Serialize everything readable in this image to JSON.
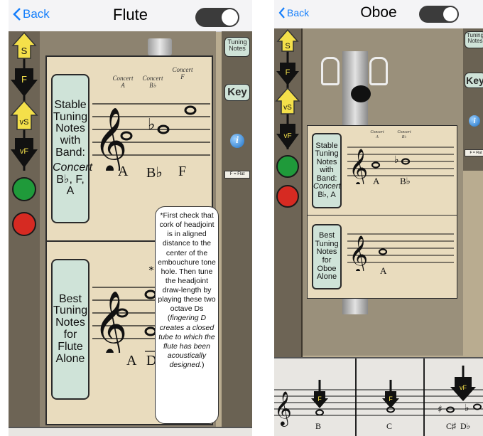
{
  "flute": {
    "back_label": "Back",
    "title": "Flute",
    "tuning_notes_button": "Tuning Notes",
    "key_button": "Key",
    "flat_key_text": "F = Flat",
    "indicators": [
      "S",
      "F",
      "vS",
      "vF"
    ],
    "stable_card": {
      "label_lines": [
        "Stable",
        "Tuning",
        "Notes",
        "with",
        "Band:"
      ],
      "label_concert": "Concert",
      "label_notes": "B♭, F, A",
      "concert_labels": [
        {
          "word": "Concert",
          "note": "A"
        },
        {
          "word": "Concert",
          "note": "B♭"
        },
        {
          "word": "Concert",
          "note": "F"
        }
      ],
      "note_names": [
        "A",
        "B♭",
        "F"
      ]
    },
    "best_card": {
      "label_lines": [
        "Best",
        "Tuning",
        "Notes",
        "for",
        "Flute",
        "Alone"
      ],
      "note_names": [
        "A",
        "D"
      ],
      "asterisk": "*",
      "note_text_pre": "*First check that cork of headjoint is in aligned distance to the center of the embouchure tone hole. Then tune the headjoint draw-length by playing these two octave Ds (",
      "note_text_italic": "fingering D creates a closed tube to which the flute has been acoustically designed.",
      "note_text_post": ")"
    }
  },
  "oboe": {
    "back_label": "Back",
    "title": "Oboe",
    "tuning_notes_button": "Tuning Notes",
    "key_button": "Key",
    "flat_key_text": "F = Flat",
    "indicators": [
      "S",
      "F",
      "vS",
      "vF"
    ],
    "stable_card": {
      "label_lines": [
        "Stable",
        "Tuning",
        "Notes",
        "with",
        "Band:"
      ],
      "label_concert": "Concert",
      "label_notes": "B♭, A",
      "concert_labels": [
        {
          "word": "Concert",
          "note": "A"
        },
        {
          "word": "Concert",
          "note": "B♭"
        }
      ],
      "note_names": [
        "A",
        "B♭"
      ]
    },
    "best_card": {
      "label_lines": [
        "Best",
        "Tuning",
        "Notes",
        "for",
        "Oboe",
        "Alone"
      ],
      "note_names": [
        "A"
      ]
    },
    "bottom_notes": [
      {
        "marker": "F",
        "name": "B"
      },
      {
        "marker": "F",
        "name": "C"
      },
      {
        "marker": "vF",
        "name": "C♯  D♭"
      }
    ]
  },
  "colors": {
    "green_light": "#1f9a3a",
    "red_light": "#d62a22",
    "indicator_yellow": "#f4e04a",
    "label_green": "#cfe3d8",
    "card_cream": "#e9dcbe"
  }
}
